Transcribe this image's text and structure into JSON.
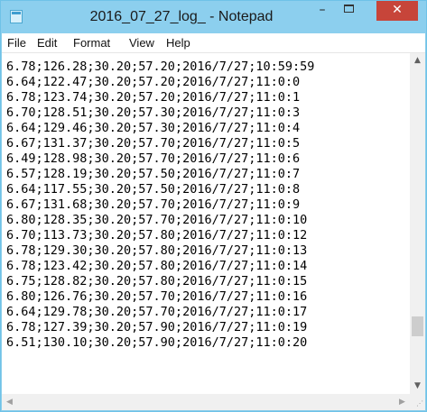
{
  "window": {
    "title": "2016_07_27_log_ - Notepad",
    "minimize_glyph": "–",
    "close_glyph": "✕"
  },
  "menu": [
    {
      "label": "File"
    },
    {
      "label": "Edit"
    },
    {
      "label": "Format"
    },
    {
      "label": "View"
    },
    {
      "label": "Help"
    }
  ],
  "editor": {
    "lines": [
      "6.78;126.28;30.20;57.20;2016/7/27;10:59:59",
      "6.64;122.47;30.20;57.20;2016/7/27;11:0:0",
      "6.78;123.74;30.20;57.20;2016/7/27;11:0:1",
      "6.70;128.51;30.20;57.30;2016/7/27;11:0:3",
      "6.64;129.46;30.20;57.30;2016/7/27;11:0:4",
      "6.67;131.37;30.20;57.70;2016/7/27;11:0:5",
      "6.49;128.98;30.20;57.70;2016/7/27;11:0:6",
      "6.57;128.19;30.20;57.50;2016/7/27;11:0:7",
      "6.64;117.55;30.20;57.50;2016/7/27;11:0:8",
      "6.67;131.68;30.20;57.70;2016/7/27;11:0:9",
      "6.80;128.35;30.20;57.70;2016/7/27;11:0:10",
      "6.70;113.73;30.20;57.80;2016/7/27;11:0:12",
      "6.78;129.30;30.20;57.80;2016/7/27;11:0:13",
      "6.78;123.42;30.20;57.80;2016/7/27;11:0:14",
      "6.75;128.82;30.20;57.80;2016/7/27;11:0:15",
      "6.80;126.76;30.20;57.70;2016/7/27;11:0:16",
      "6.64;129.78;30.20;57.70;2016/7/27;11:0:17",
      "6.78;127.39;30.20;57.90;2016/7/27;11:0:19",
      "6.51;130.10;30.20;57.90;2016/7/27;11:0:20"
    ]
  },
  "icons": {
    "app": "notepad-icon",
    "scroll_up": "chevron-up-icon",
    "scroll_down": "chevron-down-icon",
    "scroll_left": "chevron-left-icon",
    "scroll_right": "chevron-right-icon",
    "resize": "resize-grip-icon"
  },
  "colors": {
    "titlebar": "#8ccfee",
    "close_button": "#c7453a",
    "editor_background": "#ffffff",
    "scrollbar": "#f0f0f0"
  }
}
